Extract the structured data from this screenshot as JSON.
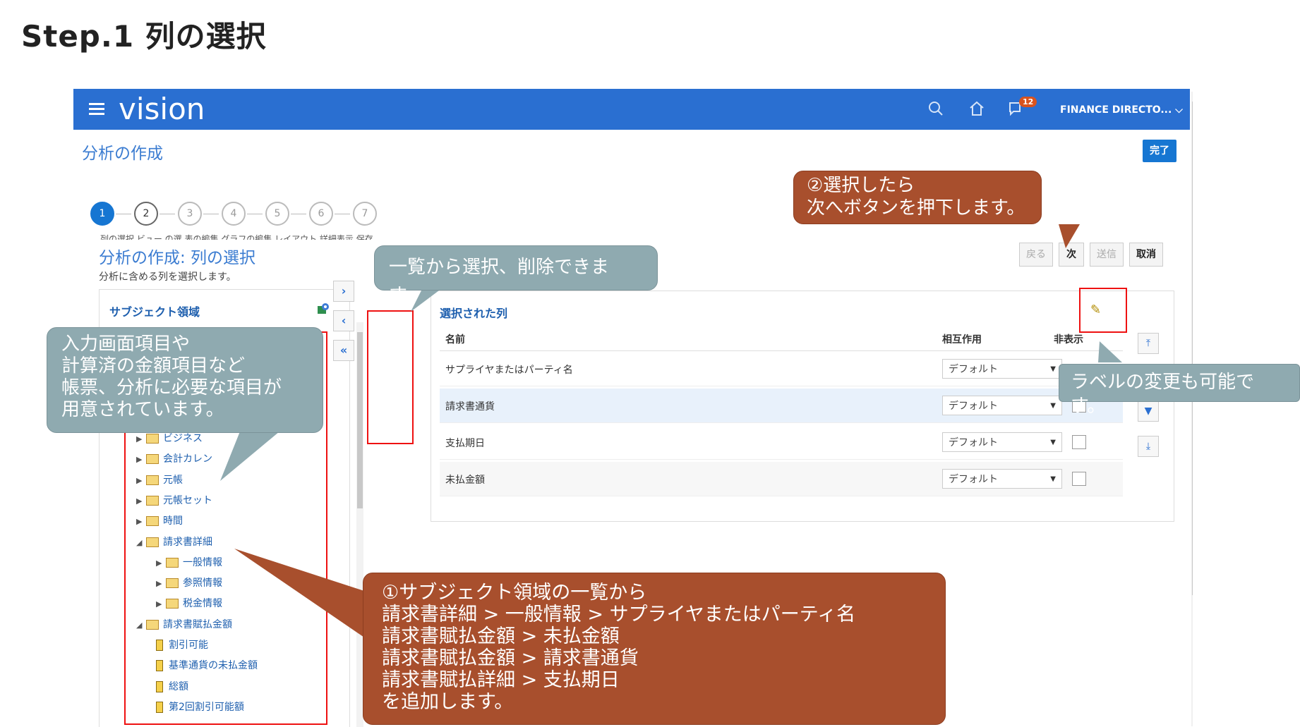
{
  "slide": {
    "title": "Step.1 列の選択"
  },
  "app": {
    "brand": "vision",
    "notification_count": "12",
    "user_menu": "FINANCE DIRECTO...",
    "page_title": "分析の作成",
    "done_label": "完了"
  },
  "train": {
    "steps": [
      "1",
      "2",
      "3",
      "4",
      "5",
      "6",
      "7"
    ],
    "labels": "列の選択 ビュー の選 表の編集 グラフの編集 レイアウト 詳細表示 保存"
  },
  "section": {
    "title": "分析の作成: 列の選択",
    "description": "分析に含める列を選択します。",
    "nav": {
      "back": "戻る",
      "next": "次",
      "submit": "送信",
      "cancel": "取消"
    }
  },
  "subject_area": {
    "title": "サブジェクト領域",
    "items": [
      {
        "label": "ビジネス",
        "level": 0,
        "kind": "folder",
        "state": "collapsed"
      },
      {
        "label": "会計カレン",
        "level": 0,
        "kind": "folder",
        "state": "collapsed"
      },
      {
        "label": "元帳",
        "level": 0,
        "kind": "folder",
        "state": "collapsed"
      },
      {
        "label": "元帳セット",
        "level": 0,
        "kind": "folder",
        "state": "collapsed"
      },
      {
        "label": "時間",
        "level": 0,
        "kind": "folder",
        "state": "collapsed"
      },
      {
        "label": "請求書詳細",
        "level": 0,
        "kind": "folder",
        "state": "expanded"
      },
      {
        "label": "一般情報",
        "level": 1,
        "kind": "folder",
        "state": "collapsed"
      },
      {
        "label": "参照情報",
        "level": 1,
        "kind": "folder",
        "state": "collapsed"
      },
      {
        "label": "税金情報",
        "level": 1,
        "kind": "folder",
        "state": "collapsed"
      },
      {
        "label": "請求書賦払金額",
        "level": 0,
        "kind": "folder",
        "state": "expanded"
      },
      {
        "label": "割引可能",
        "level": 1,
        "kind": "column"
      },
      {
        "label": "基準通貨の未払金額",
        "level": 1,
        "kind": "column"
      },
      {
        "label": "総額",
        "level": 1,
        "kind": "column"
      },
      {
        "label": "第2回割引可能額",
        "level": 1,
        "kind": "column"
      }
    ]
  },
  "selected_columns": {
    "title": "選択された列",
    "headers": {
      "name": "名前",
      "interaction": "相互作用",
      "hidden": "非表示"
    },
    "rows": [
      {
        "name": "サプライヤまたはパーティ名",
        "interaction": "デフォルト"
      },
      {
        "name": "請求書通貨",
        "interaction": "デフォルト"
      },
      {
        "name": "支払期日",
        "interaction": "デフォルト"
      },
      {
        "name": "未払金額",
        "interaction": "デフォルト"
      }
    ]
  },
  "callouts": {
    "next_step": [
      "②選択したら",
      "次へボタンを押下します。"
    ],
    "list_ops": "一覧から選択、削除できます。",
    "subject_info": [
      "入力画面項目や",
      "計算済の金額項目など",
      "帳票、分析に必要な項目が",
      "用意されています。"
    ],
    "label_change": "ラベルの変更も可能です。",
    "add_steps": [
      "①サブジェクト領域の一覧から",
      "請求書詳細 > 一般情報 > サプライヤまたはパーティ名",
      "請求書賦払金額 > 未払金額",
      "請求書賦払金額 > 請求書通貨",
      "請求書賦払詳細 > 支払期日",
      "を追加します。"
    ]
  },
  "colors": {
    "header_bar": "#2a6fd1",
    "callout_gray": "#8faab0",
    "callout_brown": "#a84f2d",
    "highlight_red": "#e11111"
  }
}
